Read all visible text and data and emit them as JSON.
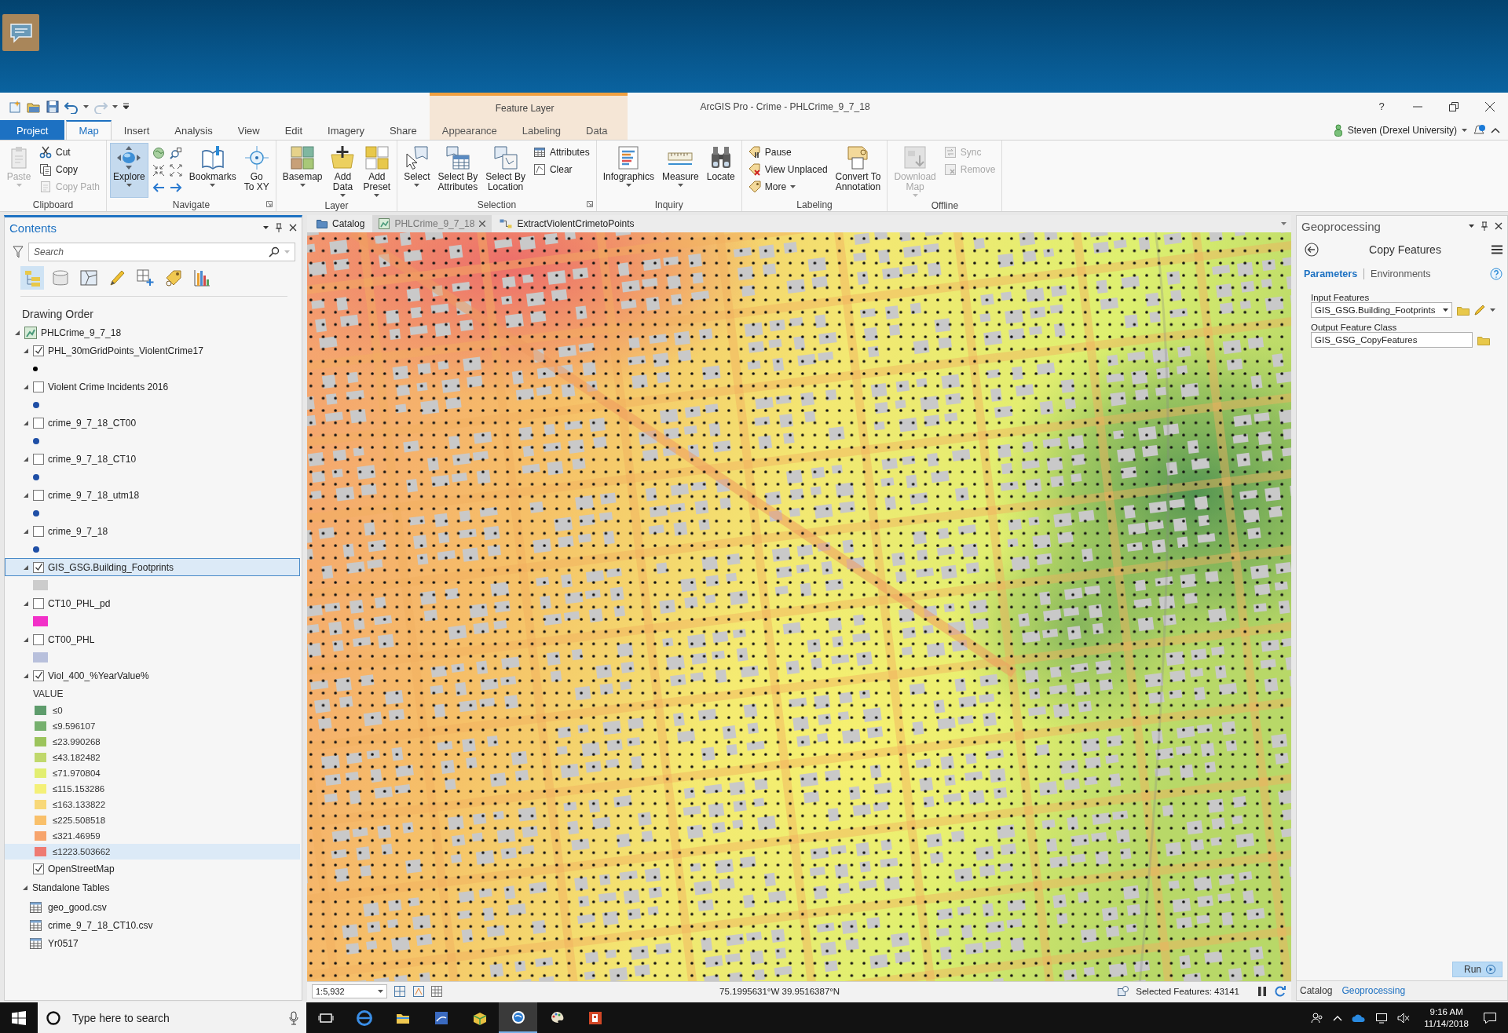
{
  "window": {
    "title": "ArcGIS Pro - Crime - PHLCrime_9_7_18",
    "help": "?",
    "user": "Steven (Drexel University)",
    "contextual_group": "Feature Layer"
  },
  "tabs": [
    {
      "label": "Project",
      "kind": "file",
      "selected": false
    },
    {
      "label": "Map",
      "kind": "normal",
      "selected": true
    },
    {
      "label": "Insert",
      "kind": "normal",
      "selected": false
    },
    {
      "label": "Analysis",
      "kind": "normal",
      "selected": false
    },
    {
      "label": "View",
      "kind": "normal",
      "selected": false
    },
    {
      "label": "Edit",
      "kind": "normal",
      "selected": false
    },
    {
      "label": "Imagery",
      "kind": "normal",
      "selected": false
    },
    {
      "label": "Share",
      "kind": "normal",
      "selected": false
    },
    {
      "label": "Appearance",
      "kind": "contextual",
      "selected": false
    },
    {
      "label": "Labeling",
      "kind": "contextual",
      "selected": false
    },
    {
      "label": "Data",
      "kind": "contextual",
      "selected": false
    }
  ],
  "ribbon": [
    {
      "label": "Clipboard",
      "launcher": false,
      "items": [
        {
          "kind": "large",
          "label": "Paste",
          "dropdown": true,
          "disabled": true,
          "selected": false
        },
        {
          "kind": "stack",
          "items": [
            {
              "label": "Cut",
              "disabled": false
            },
            {
              "label": "Copy",
              "disabled": false
            },
            {
              "label": "Copy Path",
              "disabled": true
            }
          ]
        }
      ]
    },
    {
      "label": "Navigate",
      "launcher": true,
      "items": [
        {
          "kind": "large",
          "label": "Explore",
          "dropdown": true,
          "disabled": false,
          "selected": true
        },
        {
          "kind": "icon_grid"
        },
        {
          "kind": "large",
          "label": "Bookmarks",
          "dropdown": true,
          "disabled": false,
          "selected": false
        },
        {
          "kind": "large",
          "label": "Go\nTo XY",
          "dropdown": false,
          "disabled": false,
          "selected": false
        }
      ]
    },
    {
      "label": "Layer",
      "launcher": false,
      "items": [
        {
          "kind": "large",
          "label": "Basemap",
          "dropdown": true,
          "disabled": false,
          "selected": false
        },
        {
          "kind": "large",
          "label": "Add\nData",
          "dropdown": true,
          "disabled": false,
          "selected": false
        },
        {
          "kind": "large",
          "label": "Add\nPreset",
          "dropdown": true,
          "disabled": false,
          "selected": false
        }
      ]
    },
    {
      "label": "Selection",
      "launcher": true,
      "items": [
        {
          "kind": "large",
          "label": "Select",
          "dropdown": true,
          "disabled": false,
          "selected": false
        },
        {
          "kind": "large",
          "label": "Select By\nAttributes",
          "dropdown": false,
          "disabled": false,
          "selected": false
        },
        {
          "kind": "large",
          "label": "Select By\nLocation",
          "dropdown": false,
          "disabled": false,
          "selected": false
        },
        {
          "kind": "stack",
          "items": [
            {
              "label": "Attributes",
              "disabled": false
            },
            {
              "label": "Clear",
              "disabled": false
            }
          ]
        }
      ]
    },
    {
      "label": "Inquiry",
      "launcher": false,
      "items": [
        {
          "kind": "large",
          "label": "Infographics",
          "dropdown": true,
          "disabled": false,
          "selected": false
        },
        {
          "kind": "large",
          "label": "Measure",
          "dropdown": true,
          "disabled": false,
          "selected": false
        },
        {
          "kind": "large",
          "label": "Locate",
          "dropdown": false,
          "disabled": false,
          "selected": false
        }
      ]
    },
    {
      "label": "Labeling",
      "launcher": false,
      "items": [
        {
          "kind": "stack",
          "items": [
            {
              "label": "Pause",
              "disabled": false
            },
            {
              "label": "View Unplaced",
              "disabled": false
            },
            {
              "label": "More",
              "disabled": false,
              "dropdown": true
            }
          ]
        },
        {
          "kind": "large",
          "label": "Convert To\nAnnotation",
          "dropdown": false,
          "disabled": false,
          "selected": false
        }
      ]
    },
    {
      "label": "Offline",
      "launcher": false,
      "items": [
        {
          "kind": "large",
          "label": "Download\nMap",
          "dropdown": true,
          "disabled": true,
          "selected": false
        },
        {
          "kind": "stack",
          "items": [
            {
              "label": "Sync",
              "disabled": true
            },
            {
              "label": "Remove",
              "disabled": true
            }
          ]
        }
      ]
    }
  ],
  "contents": {
    "title": "Contents",
    "search_placeholder": "Search",
    "views": [
      {
        "selected": true
      },
      {
        "selected": false
      },
      {
        "selected": false
      },
      {
        "selected": false
      },
      {
        "selected": false
      },
      {
        "selected": false
      },
      {
        "selected": false
      }
    ],
    "heading": "Drawing Order",
    "map": {
      "name": "PHLCrime_9_7_18",
      "expanded": true
    },
    "layers": [
      {
        "name": "PHL_30mGridPoints_ViolentCrime17",
        "checked": true,
        "selected": false,
        "expanded": true,
        "symbol": {
          "kind": "marker",
          "color": "#000000"
        }
      },
      {
        "name": "Violent Crime Incidents 2016",
        "checked": false,
        "selected": false,
        "expanded": true,
        "symbol": {
          "kind": "marker",
          "color": "#1f4fa6"
        }
      },
      {
        "name": "crime_9_7_18_CT00",
        "checked": false,
        "selected": false,
        "expanded": true,
        "symbol": {
          "kind": "marker",
          "color": "#1f4fa6"
        }
      },
      {
        "name": "crime_9_7_18_CT10",
        "checked": false,
        "selected": false,
        "expanded": true,
        "symbol": {
          "kind": "marker",
          "color": "#1f4fa6"
        }
      },
      {
        "name": "crime_9_7_18_utm18",
        "checked": false,
        "selected": false,
        "expanded": true,
        "symbol": {
          "kind": "marker",
          "color": "#1f4fa6"
        }
      },
      {
        "name": "crime_9_7_18",
        "checked": false,
        "selected": false,
        "expanded": true,
        "symbol": {
          "kind": "marker",
          "color": "#1f4fa6"
        }
      },
      {
        "name": "GIS_GSG.Building_Footprints",
        "checked": true,
        "selected": true,
        "expanded": true,
        "symbol": {
          "kind": "fill",
          "color": "#cccccc"
        }
      },
      {
        "name": "CT10_PHL_pd",
        "checked": false,
        "selected": false,
        "expanded": true,
        "symbol": {
          "kind": "fill",
          "color": "#f230c8"
        }
      },
      {
        "name": "CT00_PHL",
        "checked": false,
        "selected": false,
        "expanded": true,
        "symbol": {
          "kind": "fill",
          "color": "#b8c0dc"
        }
      },
      {
        "name": "Viol_400_%YearValue%",
        "checked": true,
        "selected": false,
        "expanded": true,
        "legend": {
          "field": "VALUE",
          "classes": [
            {
              "label": "≤0",
              "color": "#5e9c6c",
              "selected": false
            },
            {
              "label": "≤9.596107",
              "color": "#76b06e",
              "selected": false
            },
            {
              "label": "≤23.990268",
              "color": "#9cc45c",
              "selected": false
            },
            {
              "label": "≤43.182482",
              "color": "#c0d86c",
              "selected": false
            },
            {
              "label": "≤71.970804",
              "color": "#e2ee70",
              "selected": false
            },
            {
              "label": "≤115.153286",
              "color": "#f4f078",
              "selected": false
            },
            {
              "label": "≤163.133822",
              "color": "#f8d878",
              "selected": false
            },
            {
              "label": "≤225.508518",
              "color": "#f9c06a",
              "selected": false
            },
            {
              "label": "≤321.46959",
              "color": "#f7a46c",
              "selected": false
            },
            {
              "label": "≤1223.503662",
              "color": "#ee7a72",
              "selected": true
            }
          ]
        }
      },
      {
        "name": "OpenStreetMap",
        "checked": true,
        "selected": false
      }
    ],
    "standalone": {
      "label": "Standalone Tables",
      "expanded": true,
      "tables": [
        "geo_good.csv",
        "crime_9_7_18_CT10.csv",
        "Yr0517"
      ]
    }
  },
  "map_tabs": [
    {
      "label": "Catalog",
      "kind": "catalog",
      "selected": false,
      "closable": false
    },
    {
      "label": "PHLCrime_9_7_18",
      "kind": "map",
      "selected": true,
      "closable": true
    },
    {
      "label": "ExtractViolentCrimetoPoints",
      "kind": "model",
      "selected": false,
      "closable": false
    }
  ],
  "status": {
    "scale": "1:5,932",
    "coordinates": "75.1995631°W 39.9516387°N",
    "selected_features": "Selected Features: 43141"
  },
  "geoprocessing": {
    "title": "Geoprocessing",
    "tool": "Copy Features",
    "tabs": [
      {
        "label": "Parameters",
        "selected": true
      },
      {
        "label": "Environments",
        "selected": false
      }
    ],
    "params": [
      {
        "label": "Input Features",
        "value": "GIS_GSG.Building_Footprints",
        "kind": "dropdown"
      },
      {
        "label": "Output Feature Class",
        "value": "GIS_GSG_CopyFeatures",
        "kind": "text"
      }
    ],
    "run": "Run",
    "pane_tabs": [
      {
        "label": "Catalog",
        "selected": false
      },
      {
        "label": "Geoprocessing",
        "selected": true
      }
    ]
  },
  "taskbar": {
    "search_placeholder": "Type here to search",
    "apps": [
      {
        "selected": false
      },
      {
        "selected": false
      },
      {
        "selected": false
      },
      {
        "selected": false
      },
      {
        "selected": false
      },
      {
        "selected": true
      },
      {
        "selected": false
      },
      {
        "selected": false
      }
    ],
    "time": "9:16 AM",
    "date": "11/14/2018"
  }
}
